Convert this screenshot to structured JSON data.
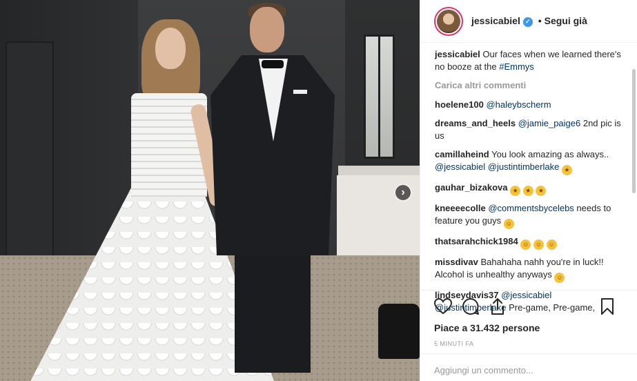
{
  "post": {
    "username": "jessicabiel",
    "follow_label": "Segui già",
    "caption_user": "jessicabiel",
    "caption_text": "Our faces when we learned there's no booze at the ",
    "caption_tag": "#Emmys",
    "load_more": "Carica altri commenti",
    "comments": [
      {
        "user": "hoelene100",
        "mention": "@haleybscherm",
        "text": ""
      },
      {
        "user": "dreams_and_heels",
        "mention": "@jamie_paige6",
        "text": " 2nd pic is us"
      },
      {
        "user": "camillaheind",
        "text": "You look amazing as always..",
        "mention": "@jessicabiel",
        "mention2": "@justintimberlake"
      },
      {
        "user": "gauhar_bizakova"
      },
      {
        "user": "kneeeecolle",
        "mention": "@commentsbycelebs",
        "text": " needs to feature you guys"
      },
      {
        "user": "thatsarahchick1984"
      },
      {
        "user": "missdivav",
        "text": "Bahahaha nahh you're in luck!! Alcohol is unhealthy anyways"
      },
      {
        "user": "lindseydavis37",
        "mention": "@jessicabiel",
        "mention2": "@justintimberlake",
        "text": " Pre-game, Pre-game,"
      }
    ],
    "likes_text": "Piace a 31.432 persone",
    "time_ago": "5 MINUTI FA",
    "add_comment_placeholder": "Aggiungi un commento..."
  },
  "icons": {
    "verified": "verified-badge-icon",
    "like": "heart-icon",
    "comment": "comment-icon",
    "share": "share-icon",
    "save": "bookmark-icon",
    "next": "chevron-right-icon"
  },
  "colors": {
    "link": "#003569",
    "verified": "#3897f0",
    "muted": "#999999"
  }
}
